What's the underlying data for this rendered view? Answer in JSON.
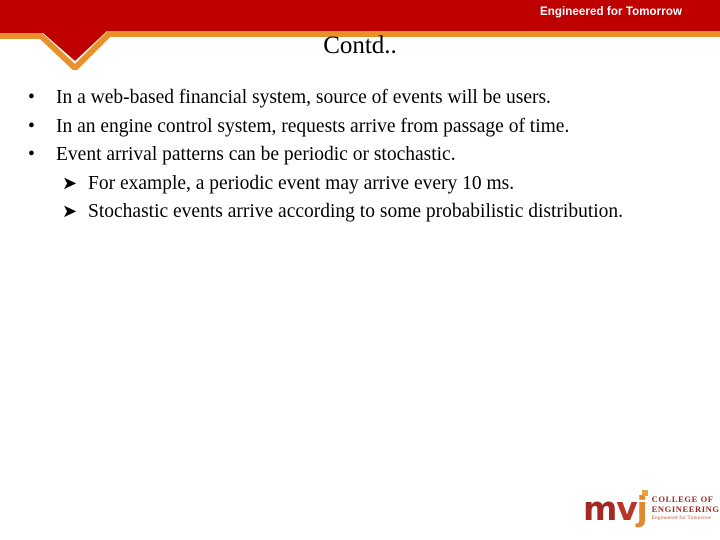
{
  "header": {
    "tagline": "Engineered for Tomorrow",
    "band_color": "#BE0000",
    "accent_color": "#E8912A"
  },
  "title": "Contd..",
  "body": {
    "bullets": [
      {
        "marker": "•",
        "text": "In a web-based financial system, source of events will be users."
      },
      {
        "marker": "•",
        "text": "In an engine control system, requests arrive from passage of time."
      },
      {
        "marker": "•",
        "text": "Event arrival patterns can be periodic or stochastic."
      }
    ],
    "subbullets": [
      {
        "marker": "➤",
        "text": "For example, a periodic event may arrive every 10 ms."
      },
      {
        "marker": "➤",
        "text": "Stochastic events arrive according to some probabilistic distribution."
      }
    ]
  },
  "logo": {
    "mark_m": "m",
    "mark_v": "v",
    "mark_j": "j",
    "line1": "COLLEGE OF",
    "line2": "ENGINEERING",
    "line3": "Engineered for Tomorrow",
    "color_primary": "#A32A22",
    "color_accent": "#E08A2E"
  }
}
